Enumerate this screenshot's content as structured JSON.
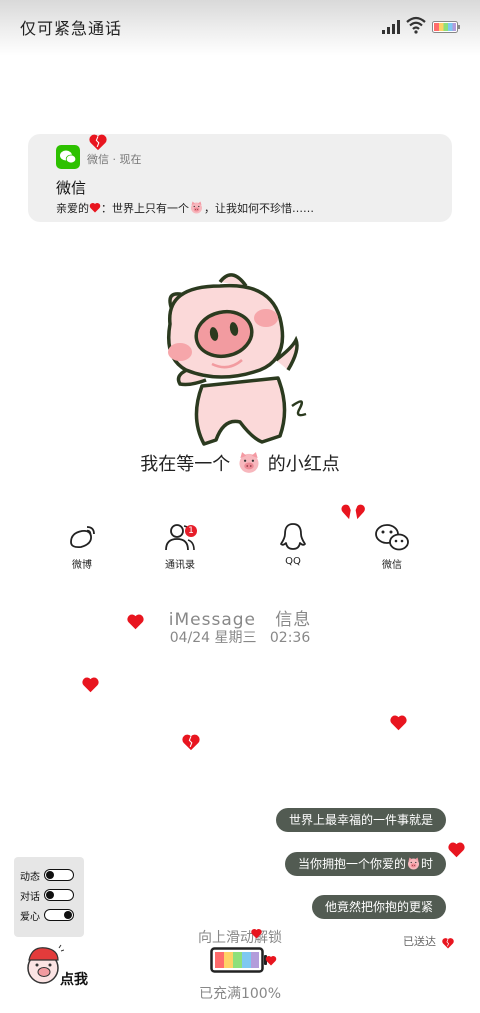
{
  "status_bar": {
    "carrier_text": "仅可紧急通话",
    "icons": [
      "signal-icon",
      "wifi-icon",
      "rainbow-battery-icon"
    ]
  },
  "notification": {
    "app_name": "微信",
    "time": "现在",
    "app_time": "微信 · 现在",
    "title": "微信",
    "body_prefix": "亲爱的",
    "body_middle": "：世界上只有一个",
    "body_suffix": "，让我如何不珍惜……",
    "icons": [
      "wechat-icon",
      "red-heart-icon",
      "pig-emoji-icon"
    ]
  },
  "pig_caption": {
    "before": "我在等一个",
    "after": "的小红点"
  },
  "shortcuts": [
    {
      "label": "微博",
      "icon": "weibo-icon"
    },
    {
      "label": "通讯录",
      "icon": "contacts-icon",
      "badge": "1"
    },
    {
      "label": "QQ",
      "icon": "qq-icon"
    },
    {
      "label": "微信",
      "icon": "wechat-icon"
    }
  ],
  "clock": {
    "imessage_label": "iMessage",
    "info_label": "信息",
    "date": "04/24 星期三",
    "time": "02:36"
  },
  "messages": [
    {
      "text": "世界上最幸福的一件事就是"
    },
    {
      "text_before": "当你拥抱一个你爱的",
      "text_after": "时"
    },
    {
      "text": "他竟然把你抱的更紧"
    }
  ],
  "delivered_label": "已送达",
  "toggles": [
    {
      "label": "动态",
      "on": false
    },
    {
      "label": "对话",
      "on": false
    },
    {
      "label": "爱心",
      "on": true
    }
  ],
  "unlock_hint": "向上滑动解锁",
  "charge_status": "已充满100%",
  "battery_level": 1.0,
  "tap_me_label": "点我",
  "colors": {
    "heart": "#e8151f",
    "bubble": "#525b52",
    "wechat_green": "#2dc100",
    "pig_pink": "#fbd9d9",
    "rainbow": [
      "#ff6b6b",
      "#ffd166",
      "#8ee07a",
      "#7ec8f2",
      "#b39ddb"
    ]
  }
}
